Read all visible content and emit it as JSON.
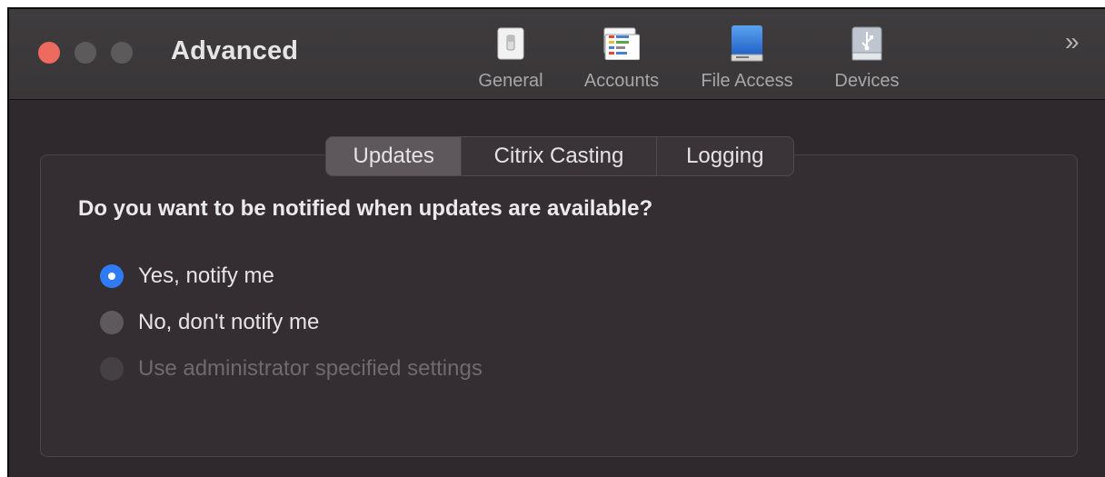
{
  "window": {
    "title": "Advanced"
  },
  "toolbar": {
    "items": [
      {
        "label": "General",
        "icon": "switch-icon"
      },
      {
        "label": "Accounts",
        "icon": "accounts-icon"
      },
      {
        "label": "File Access",
        "icon": "drive-icon"
      },
      {
        "label": "Devices",
        "icon": "usb-icon"
      }
    ],
    "overflow_symbol": "»"
  },
  "tabs": [
    {
      "label": "Updates",
      "selected": true
    },
    {
      "label": "Citrix Casting",
      "selected": false
    },
    {
      "label": "Logging",
      "selected": false
    }
  ],
  "updates": {
    "question": "Do you want to be notified when updates are available?",
    "options": [
      {
        "label": "Yes, notify me",
        "checked": true,
        "enabled": true
      },
      {
        "label": "No, don't notify me",
        "checked": false,
        "enabled": true
      },
      {
        "label": "Use administrator specified settings",
        "checked": false,
        "enabled": false
      }
    ]
  },
  "colors": {
    "accent": "#2f7bf5",
    "close": "#ed6a5e",
    "background": "#2f292d"
  }
}
